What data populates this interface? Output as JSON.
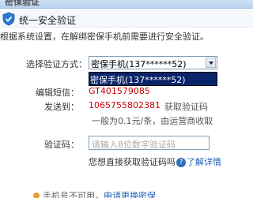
{
  "window": {
    "title_fragment": "密保验证"
  },
  "section": {
    "title": "统一安全验证"
  },
  "notice": "根据系统设置，在解绑密保手机前需要进行安全验证。",
  "form": {
    "method_label": "选择验证方式：",
    "method_selected": "密保手机(137******52)",
    "method_options": [
      "密保手机(137******52)"
    ],
    "sms_label": "编辑短信：",
    "sms_code": "GT401579085",
    "send_to_label": "发送到：",
    "send_to_number": "1065755802381",
    "get_code_text": "获取验证码",
    "fee_note": "一般为0.1元/条，由运营商收取",
    "code_label": "验证码：",
    "code_placeholder": "请输入8位数字验证码",
    "help_text": "您想直接获取验证码吗",
    "help_q": "?",
    "help_link": "了解详情"
  },
  "footer": {
    "text_prefix": "手机号不可用，",
    "text_link": "申请更换密保"
  },
  "colors": {
    "accent_blue": "#1f5fb8",
    "value_red": "#cc0000",
    "select_highlight": "#0a246a"
  }
}
